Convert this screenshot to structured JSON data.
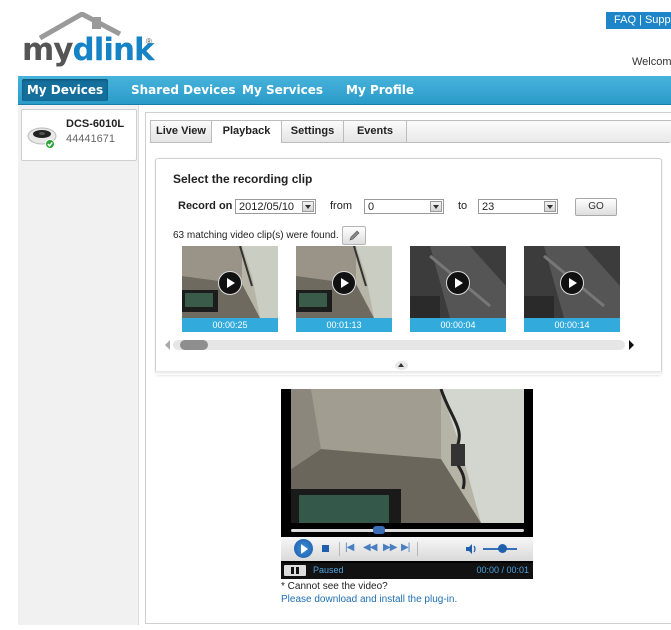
{
  "header": {
    "logo_part1": "my",
    "logo_part2": "dlink",
    "logo_tm": "®",
    "faq_support": "FAQ | Supp",
    "welcome": "Welcom"
  },
  "nav": {
    "tabs": [
      {
        "label": "My Devices",
        "active": true
      },
      {
        "label": "Shared Devices",
        "active": false
      },
      {
        "label": "My Services",
        "active": false
      },
      {
        "label": "My Profile",
        "active": false
      }
    ]
  },
  "sidebar": {
    "device_name": "DCS-6010L",
    "device_id": "44441671",
    "status_icon": "check-icon"
  },
  "tabs": [
    {
      "label": "Live View",
      "active": false
    },
    {
      "label": "Playback",
      "active": true
    },
    {
      "label": "Settings",
      "active": false
    },
    {
      "label": "Events",
      "active": false
    }
  ],
  "recording": {
    "title": "Select the recording clip",
    "record_on_label": "Record on",
    "date_value": "2012/05/10",
    "from_label": "from",
    "from_value": "0",
    "to_label": "to",
    "to_value": "23",
    "go_label": "GO",
    "match_text": "63  matching video clip(s) were found.",
    "clips": [
      {
        "time": "00:00:25"
      },
      {
        "time": "00:01:13"
      },
      {
        "time": "00:00:04"
      },
      {
        "time": "00:00:14"
      }
    ]
  },
  "player": {
    "status": "Paused",
    "time": "00:00 / 00:01",
    "seek_position": 0.37,
    "volume_level": 0.6
  },
  "notes": {
    "line1": "* Cannot see the video?",
    "line2": "Please download and install the plug-in."
  },
  "colors": {
    "brand_blue": "#1583c5",
    "nav_blue": "#2a9bc9",
    "clip_time_bar": "#32aadc"
  }
}
